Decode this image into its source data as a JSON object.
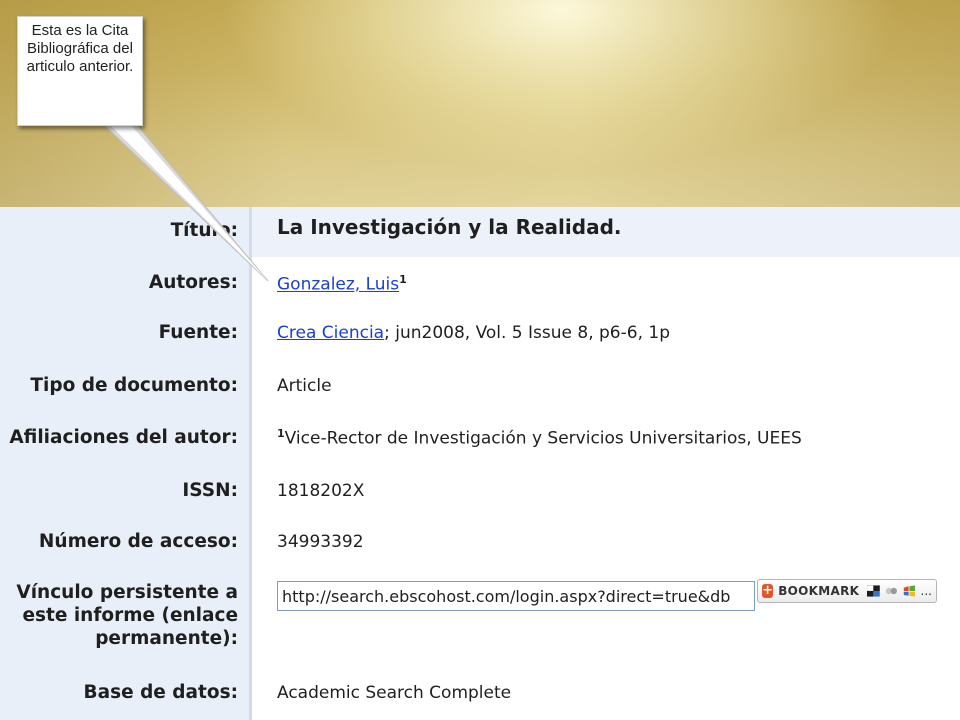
{
  "callout": {
    "text": "Esta es la Cita Bibliográfica del articulo anterior."
  },
  "record": {
    "fields": [
      {
        "label": "Título:",
        "value": "La Investigación y la Realidad."
      },
      {
        "label": "Autores:",
        "link": "Gonzalez, Luis",
        "sup": "1"
      },
      {
        "label": "Fuente:",
        "link": "Crea Ciencia",
        "value": "; jun2008, Vol. 5 Issue 8, p6-6, 1p"
      },
      {
        "label": "Tipo de documento:",
        "value": "Article"
      },
      {
        "label": "Afiliaciones del autor:",
        "sup": "1",
        "value": "Vice-Rector de Investigación y Servicios Universitarios, UEES"
      },
      {
        "label": "ISSN:",
        "value": "1818202X"
      },
      {
        "label": "Número de acceso:",
        "value": "34993392"
      },
      {
        "label_lines": [
          "Vínculo persistente a",
          "este informe (enlace",
          "permanente):"
        ],
        "value": "http://search.ebscohost.com/login.aspx?direct=true&db"
      },
      {
        "label": "Base de datos:",
        "value": "Academic Search Complete"
      }
    ]
  },
  "bookmark": {
    "label": "BOOKMARK",
    "more": "..."
  },
  "colors": {
    "link": "#1a3fd6",
    "label_column": "#e8eff9",
    "bookmark_accent": "#e2552c"
  },
  "icons": [
    "bookmark-plus-icon",
    "delicious-icon",
    "digg-icon",
    "windows-live-icon"
  ]
}
